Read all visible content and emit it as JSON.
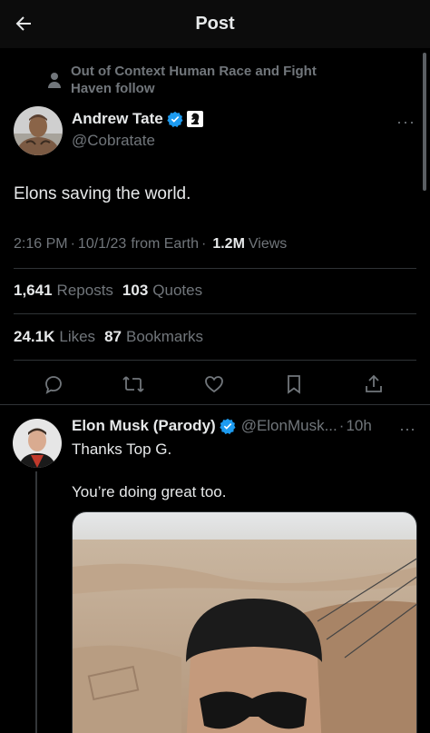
{
  "header": {
    "title": "Post"
  },
  "social_context": {
    "text": "Out of Context Human Race and Fight Haven follow"
  },
  "tweet": {
    "author_name": "Andrew Tate",
    "author_handle": "@Cobratate",
    "text": "Elons saving the world.",
    "time": "2:16 PM",
    "date": "10/1/23",
    "source": "from Earth",
    "views_count": "1.2M",
    "views_label": "Views",
    "reposts_count": "1,641",
    "reposts_label": "Reposts",
    "quotes_count": "103",
    "quotes_label": "Quotes",
    "likes_count": "24.1K",
    "likes_label": "Likes",
    "bookmarks_count": "87",
    "bookmarks_label": "Bookmarks",
    "more_label": "···"
  },
  "reply": {
    "author_name": "Elon Musk (Parody)",
    "author_handle": "@ElonMusk...",
    "time": "10h",
    "line1": "Thanks Top G.",
    "line2": "You’re doing great too.",
    "more_label": "···"
  },
  "icons": {
    "back": "arrow-left-icon",
    "verified": "verified-badge-icon",
    "reply": "reply-icon",
    "repost": "repost-icon",
    "like": "heart-icon",
    "bookmark": "bookmark-icon",
    "share": "share-icon"
  },
  "colors": {
    "background": "#000000",
    "text": "#e7e9ea",
    "muted": "#71767b",
    "verified": "#1d9bf0",
    "divider": "#2f3336"
  }
}
